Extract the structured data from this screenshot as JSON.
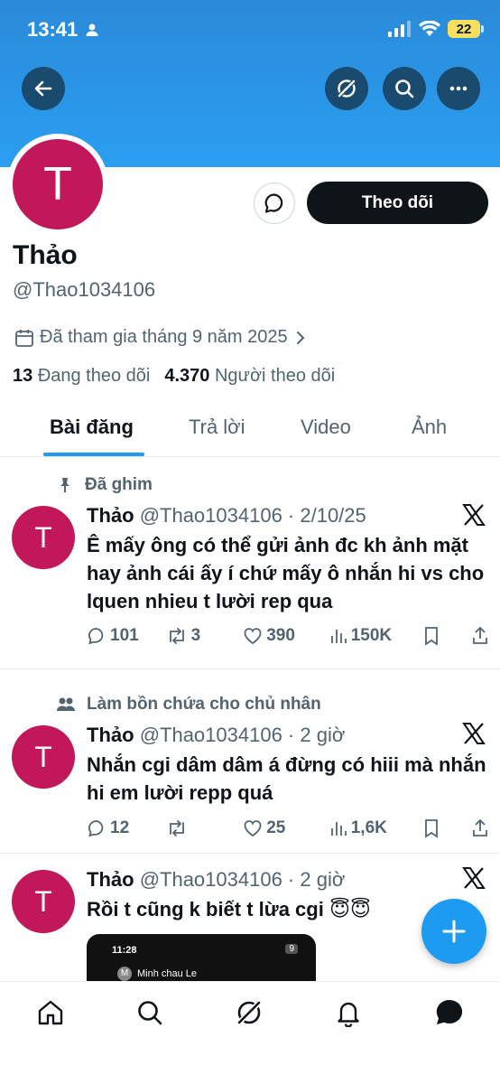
{
  "status_bar": {
    "time": "13:41",
    "battery": "22"
  },
  "profile": {
    "avatar_letter": "T",
    "name": "Thảo",
    "handle": "@Thao1034106",
    "joined": "Đã tham gia tháng 9 năm 2025",
    "following_count": "13",
    "following_label": "Đang theo dõi",
    "followers_count": "4.370",
    "followers_label": "Người theo dõi",
    "follow_button": "Theo dõi"
  },
  "tabs": [
    {
      "label": "Bài đăng",
      "active": true
    },
    {
      "label": "Trả lời",
      "active": false
    },
    {
      "label": "Video",
      "active": false
    },
    {
      "label": "Ảnh",
      "active": false
    }
  ],
  "tweets": [
    {
      "context": "Đã ghim",
      "name": "Thảo",
      "handle_time": "@Thao1034106 · 2/10/25",
      "text": "Ê mấy ông có thể gửi ảnh đc kh ảnh mặt hay ảnh cái ấy í chứ mấy ô nhắn hi vs cho lquen nhieu t lười rep qua",
      "replies": "101",
      "retweets": "3",
      "likes": "390",
      "views": "150K"
    },
    {
      "context": "Làm bồn chứa cho chủ nhân",
      "name": "Thảo",
      "handle_time": "@Thao1034106 · 2 giờ",
      "text": "Nhắn cgi dâm dâm á đừng có hiii mà nhắn hi em lười repp quá",
      "replies": "12",
      "retweets": "",
      "likes": "25",
      "views": "1,6K"
    },
    {
      "name": "Thảo",
      "handle_time": "@Thao1034106 · 2 giờ",
      "text": "Rồi t cũng k biết t lừa cgi 😇😇",
      "thumb_time": "11:28",
      "thumb_contact": "Minh chau Le",
      "thumb_battery": "9"
    }
  ],
  "colors": {
    "accent": "#1d9bf0",
    "avatar": "#c2185b",
    "banner": "#2b9ef1"
  }
}
